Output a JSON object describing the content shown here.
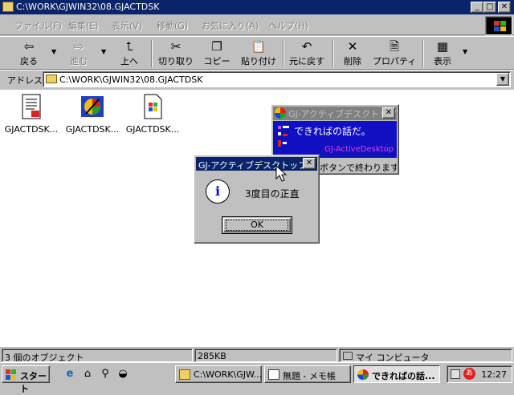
{
  "window": {
    "title": "C:\\WORK\\GJWIN32\\08.GJACTDSK",
    "minimize": "_",
    "maximize": "□",
    "close": "✕"
  },
  "menu": [
    "ファイル(F)",
    "編集(E)",
    "表示(V)",
    "移動(G)",
    "お気に入り(A)",
    "ヘルプ(H)"
  ],
  "toolbar": {
    "back": "戻る",
    "forward": "進む",
    "up": "上へ",
    "cut": "切り取り",
    "copy": "コピー",
    "paste": "貼り付け",
    "undo": "元に戻す",
    "delete": "削除",
    "properties": "プロパティ",
    "view": "表示"
  },
  "address": {
    "label": "アドレス",
    "value": "C:\\WORK\\GJWIN32\\08.GJACTDSK"
  },
  "files": [
    {
      "name": "GJACTDSK...",
      "icon": "document-icon"
    },
    {
      "name": "GJACTDSK...",
      "icon": "gj-app-icon"
    },
    {
      "name": "GJACTDSK...",
      "icon": "windows-file-icon"
    }
  ],
  "status": {
    "objects": "3 個のオブジェクト",
    "size": "285KB",
    "location": "マイ コンピュータ"
  },
  "taskbar": {
    "start": "スタート",
    "tasks": [
      {
        "label": "C:\\WORK\\GJW...",
        "active": false
      },
      {
        "label": "無題 - メモ帳",
        "active": false
      },
      {
        "label": "できればの話...",
        "active": true
      }
    ],
    "clock": "12:27"
  },
  "gj_window": {
    "title": "GJ-アクティブデスクトップ",
    "message": "できればの話だ。",
    "brand": "GJ-ActiveDesktop",
    "status_partial": "ボタンで終わります。",
    "close": "✕"
  },
  "dialog": {
    "title": "GJ-アクティブデスクトップ",
    "message": "3度目の正直",
    "ok": "OK",
    "info_glyph": "i",
    "close": "✕"
  },
  "colors": {
    "title_active": "#0a246a",
    "title_inactive": "#808080",
    "gj_body": "#1010c0",
    "gj_brand": "#e040e0"
  }
}
